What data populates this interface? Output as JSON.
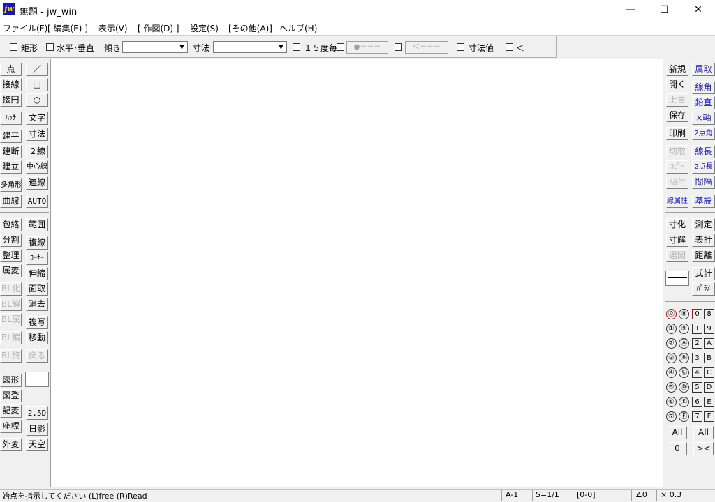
{
  "window": {
    "app_icon": "jw",
    "title": "無題 - jw_win",
    "minimize": "—",
    "maximize": "☐",
    "close": "✕"
  },
  "menu": [
    "ファイル(F)",
    "[ 編集(E) ]",
    "表示(V)",
    "[ 作図(D) ]",
    "設定(S)",
    "[その他(A)]",
    "ヘルプ(H)"
  ],
  "toolbar": {
    "rect": "矩形",
    "hv": "水平･垂直",
    "tilt": "傾き",
    "tilt_value": "",
    "dim": "寸法",
    "dim_value": "",
    "deg15": "１５度毎",
    "dot_button": "●－－－",
    "arrow_button": "＜－－－",
    "dim_value_chk": "寸法値",
    "lt": "＜"
  },
  "left_tools": {
    "col1": [
      "点",
      "接線",
      "接円",
      "ﾊｯﾁ",
      "建平",
      "建断",
      "建立",
      "多角形",
      "曲線",
      "包絡",
      "分割",
      "整理",
      "属変",
      "BL化",
      "BL解",
      "BL属",
      "BL編",
      "BL終",
      "図形",
      "図登",
      "記変",
      "座標",
      "外変"
    ],
    "col2": [
      "／",
      "□",
      "○",
      "文字",
      "寸法",
      "２線",
      "中心線",
      "連線",
      "AUTO",
      "範囲",
      "複線",
      "ｺｰﾅｰ",
      "伸縮",
      "面取",
      "消去",
      "複写",
      "移動",
      "戻る",
      "2.5D",
      "日影",
      "天空"
    ]
  },
  "right_tools": {
    "col1": [
      "新規",
      "開く",
      "上書",
      "保存",
      "印刷",
      "切取",
      "ｺﾋﾟｰ",
      "貼付",
      "線属性",
      "寸化",
      "寸解",
      "選図"
    ],
    "col2": [
      "属取",
      "線角",
      "鉛直",
      "×軸",
      "2点角",
      "線長",
      "2点長",
      "間隔",
      "基設",
      "測定",
      "表計",
      "距離",
      "式計",
      "ﾊﾟﾗﾒ"
    ]
  },
  "layer_groups": [
    "⓪",
    "⑧",
    "①",
    "⑨",
    "②",
    "Ⓐ",
    "③",
    "Ⓑ",
    "④",
    "Ⓒ",
    "⑤",
    "Ⓓ",
    "⑥",
    "Ⓔ",
    "⑦",
    "Ⓕ"
  ],
  "layers": [
    "0",
    "8",
    "1",
    "9",
    "2",
    "A",
    "3",
    "B",
    "4",
    "C",
    "5",
    "D",
    "6",
    "E",
    "7",
    "F"
  ],
  "layer_all_left": "All",
  "layer_all_right": "All",
  "layer_zero": "0",
  "layer_cross": "><",
  "status": {
    "message": "始点を指示してください (L)free (R)Read",
    "paper": "A-1",
    "scale": "S=1/1",
    "layer": "[0-0]",
    "angle": "∠0",
    "zoom": "× 0.3"
  },
  "colors": {
    "blue_text": "#1a1ab0",
    "disabled_text": "#b4b4b4",
    "layer_active_border": "#dd0000"
  }
}
